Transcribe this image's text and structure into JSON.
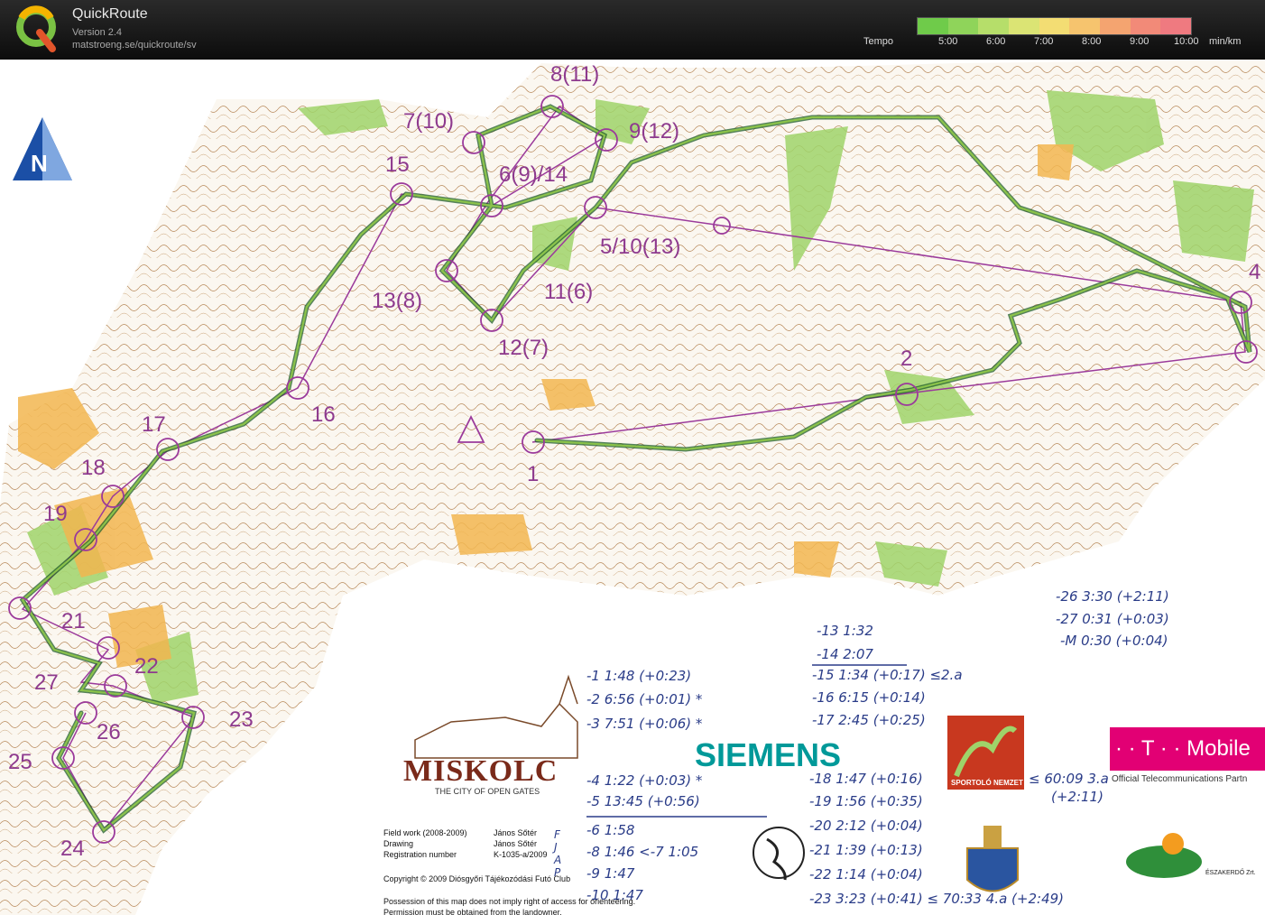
{
  "header": {
    "title": "QuickRoute",
    "version": "Version 2.4",
    "url": "matstroeng.se/quickroute/sv",
    "tempo_label": "Tempo",
    "tempo_ticks": [
      "5:00",
      "6:00",
      "7:00",
      "8:00",
      "9:00",
      "10:00"
    ],
    "tempo_unit": "min/km",
    "tempo_colors": [
      "#6fcb4a",
      "#8fd45a",
      "#b6de6a",
      "#dbe474",
      "#f3dd73",
      "#f6c46e",
      "#f4a470",
      "#f28a78",
      "#ef7a80"
    ]
  },
  "map": {
    "north_label": "N",
    "controls": [
      {
        "id": "c1",
        "label": "1"
      },
      {
        "id": "c2",
        "label": "2"
      },
      {
        "id": "c4",
        "label": "4"
      },
      {
        "id": "c5",
        "label": "5/10(13)"
      },
      {
        "id": "c6",
        "label": "6(9)/14"
      },
      {
        "id": "c7",
        "label": "7(10)"
      },
      {
        "id": "c8",
        "label": "8(11)"
      },
      {
        "id": "c9",
        "label": "9(12)"
      },
      {
        "id": "c11",
        "label": "11(6)"
      },
      {
        "id": "c12",
        "label": "12(7)"
      },
      {
        "id": "c13",
        "label": "13(8)"
      },
      {
        "id": "c15",
        "label": "15"
      },
      {
        "id": "c16",
        "label": "16"
      },
      {
        "id": "c17",
        "label": "17"
      },
      {
        "id": "c18",
        "label": "18"
      },
      {
        "id": "c19",
        "label": "19"
      },
      {
        "id": "c21",
        "label": "21"
      },
      {
        "id": "c22",
        "label": "22"
      },
      {
        "id": "c23",
        "label": "23"
      },
      {
        "id": "c24",
        "label": "24"
      },
      {
        "id": "c25",
        "label": "25"
      },
      {
        "id": "c26",
        "label": "26"
      },
      {
        "id": "c27",
        "label": "27"
      }
    ],
    "split_notes": [
      "-26 3:30 (+2:11)",
      "-27 0:31 (+0:03)",
      "-M 0:30 (+0:04)",
      "-13 1:32",
      "-14 2:07",
      "-15 1:34 (+0:17) ≤2.a",
      "-16 6:15 (+0:14)",
      "-17 2:45 (+0:25)",
      "-1 1:48 (+0:23)",
      "-2 6:56 (+0:01) *",
      "-3 7:51 (+0:06) *",
      "-4 1:22 (+0:03) *",
      "-5 13:45 (+0:56)",
      "-6 1:58",
      "-8 1:46 <-7 1:05",
      "-9 1:47",
      "-10 1:47",
      "-18 1:47 (+0:16)",
      "-19 1:56 (+0:35)",
      "-20 2:12 (+0:04)",
      "-21 1:39 (+0:13)",
      "-22 1:14 (+0:04)",
      "-23 3:23 (+0:41) ≤ 70:33 4.a (+2:49)",
      "≤ 60:09 3.a",
      "(+2:11)"
    ],
    "side_letters": "F J A P",
    "sponsors": {
      "miskolc": "MISKOLC",
      "miskolc_sub": "THE CITY OF OPEN GATES",
      "siemens": "SIEMENS",
      "sportolo": "SPORTOLÓ NEMZET",
      "tmobile": "· · T · · Mobile",
      "tmobile_sub": "Official Telecommunications Partn",
      "eszakerdo": "ÉSZAKERDŐ Zrt."
    },
    "credits": {
      "field_work_label": "Field work (2008-2009)",
      "field_work": "János Sőtér",
      "drawing_label": "Drawing",
      "drawing": "János Sőtér",
      "registration_label": "Registration number",
      "registration": "K-1035-a/2009",
      "copyright": "Copyright © 2009 Diósgyőri Tájékozódási Futó Club",
      "possession": "Possession of this map does not imply right of access for orienteering.",
      "permission": "Permission must be obtained from the landowner."
    }
  }
}
